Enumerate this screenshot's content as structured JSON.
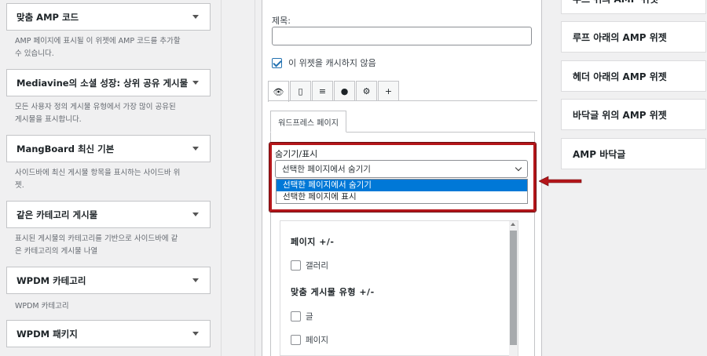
{
  "available_widgets": [
    {
      "title": "맞춤 AMP 코드",
      "description_lines": [
        "AMP 페이지에 표시될 이 위젯에 AMP 코드를 추가할",
        "수 있습니다."
      ]
    },
    {
      "title": "Mediavine의 소셜 성장: 상위 공유 게시물",
      "description_lines": [
        "모든 사용자 정의 게시물 유형에서 가장 많이 공유된",
        "게시물을 표시합니다."
      ]
    },
    {
      "title": "MangBoard 최신 기본",
      "description_lines": [
        "사이드바에 최신 게시물 항목을 표시하는 사이드바 위",
        "젯."
      ]
    },
    {
      "title": "같은 카테고리 게시물",
      "description_lines": [
        "표시된 게시물의 카테고리를 기반으로 사이드바에 같",
        "은 카테고리의 게시물 나열"
      ]
    },
    {
      "title": "WPDM 카테고리",
      "description_lines": [
        "WPDM 카테고리"
      ]
    },
    {
      "title": "WPDM 패키지",
      "description_lines": []
    }
  ],
  "widget_form": {
    "title_label": "제목:",
    "title_value": "",
    "cache_checkbox_label": "이 위젯을 캐시하지 않음",
    "cache_checked": true,
    "icon_tabs": [
      "eye-icon",
      "mobile-icon",
      "align-icon",
      "user-icon",
      "gear-icon",
      "plus-icon"
    ],
    "icon_tab_glyphs": [
      "👁",
      "▯",
      "≡",
      "●",
      "⚙",
      "+"
    ],
    "page_tab_label": "워드프레스 페이지",
    "visibility_label": "숨기기/표시",
    "visibility_selected": "선택한 페이지에서 숨기기",
    "visibility_options": [
      "선택한 페이지에서 숨기기",
      "선택한 페이지에 표시"
    ],
    "pages_heading": "페이지 +/-",
    "pages_items": [
      "갤러리"
    ],
    "post_types_heading": "맞춤 게시물 유형 +/-",
    "post_type_items": [
      "글",
      "페이지"
    ]
  },
  "amp_areas": [
    {
      "label": "루프 위의 AMP 위젯"
    },
    {
      "label": "루프 아래의 AMP 위젯"
    },
    {
      "label": "헤더 아래의 AMP 위젯"
    },
    {
      "label": "바닥글 위의 AMP 위젯"
    },
    {
      "label": "AMP 바닥글"
    }
  ],
  "colors": {
    "highlight_frame": "#b4161a",
    "selected_option": "#0078d7",
    "accent": "#2271b1"
  }
}
